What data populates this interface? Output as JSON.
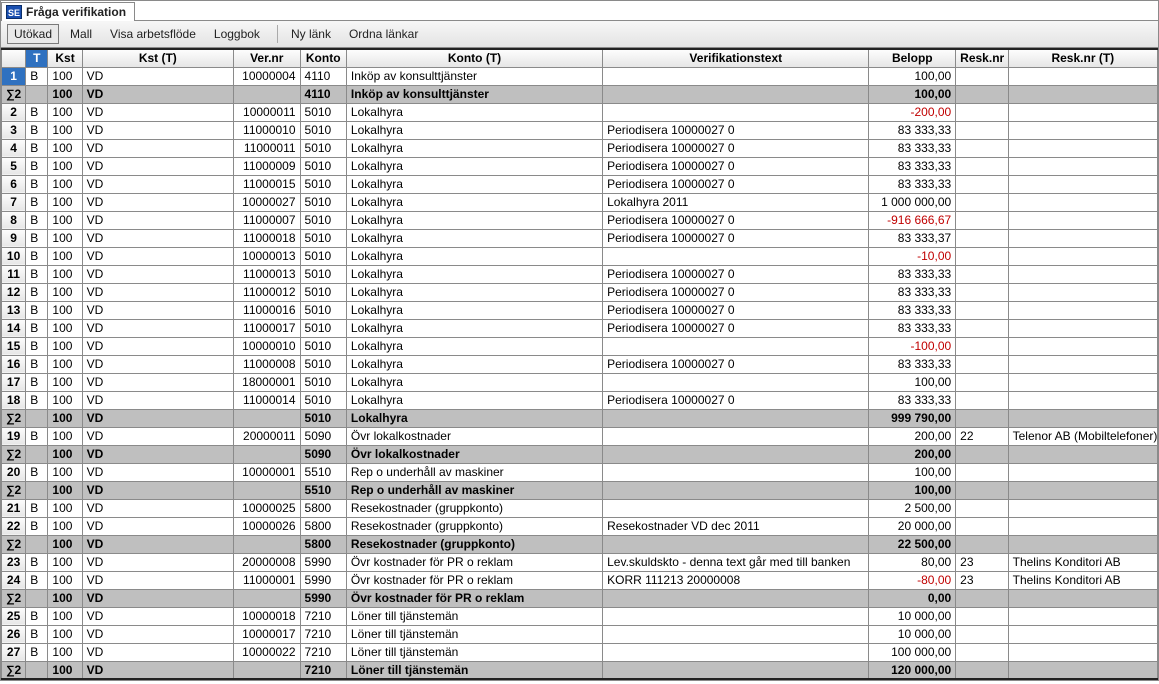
{
  "window": {
    "title": "Fråga verifikation",
    "se_badge": "SE"
  },
  "toolbar": {
    "utokad": "Utökad",
    "mall": "Mall",
    "visa_arbetsflode": "Visa arbetsflöde",
    "loggbok": "Loggbok",
    "ny_lank": "Ny länk",
    "ordna_lankar": "Ordna länkar"
  },
  "columns": {
    "t": "T",
    "kst": "Kst",
    "kstt": "Kst (T)",
    "ver": "Ver.nr",
    "konto": "Konto",
    "kontot": "Konto (T)",
    "vtext": "Verifikationstext",
    "belopp": "Belopp",
    "resk": "Resk.nr",
    "reskt": "Resk.nr (T)"
  },
  "sigma": "∑2",
  "rows": [
    {
      "type": "data",
      "idx": "1",
      "sel": true,
      "t": "B",
      "kst": "100",
      "kstt": "VD",
      "ver": "10000004",
      "konto": "4110",
      "kontot": "Inköp av konsulttjänster",
      "vtext": "",
      "belopp": "100,00",
      "resk": "",
      "reskt": ""
    },
    {
      "type": "sum",
      "kst": "100",
      "kstt": "VD",
      "konto": "4110",
      "kontot": "Inköp av konsulttjänster",
      "belopp": "100,00"
    },
    {
      "type": "data",
      "idx": "2",
      "t": "B",
      "kst": "100",
      "kstt": "VD",
      "ver": "10000011",
      "konto": "5010",
      "kontot": "Lokalhyra",
      "vtext": "",
      "belopp": "-200,00",
      "neg": true,
      "resk": "",
      "reskt": ""
    },
    {
      "type": "data",
      "idx": "3",
      "t": "B",
      "kst": "100",
      "kstt": "VD",
      "ver": "11000010",
      "konto": "5010",
      "kontot": "Lokalhyra",
      "vtext": "Periodisera 10000027 0",
      "belopp": "83 333,33",
      "resk": "",
      "reskt": ""
    },
    {
      "type": "data",
      "idx": "4",
      "t": "B",
      "kst": "100",
      "kstt": "VD",
      "ver": "11000011",
      "konto": "5010",
      "kontot": "Lokalhyra",
      "vtext": "Periodisera 10000027 0",
      "belopp": "83 333,33",
      "resk": "",
      "reskt": ""
    },
    {
      "type": "data",
      "idx": "5",
      "t": "B",
      "kst": "100",
      "kstt": "VD",
      "ver": "11000009",
      "konto": "5010",
      "kontot": "Lokalhyra",
      "vtext": "Periodisera 10000027 0",
      "belopp": "83 333,33",
      "resk": "",
      "reskt": ""
    },
    {
      "type": "data",
      "idx": "6",
      "t": "B",
      "kst": "100",
      "kstt": "VD",
      "ver": "11000015",
      "konto": "5010",
      "kontot": "Lokalhyra",
      "vtext": "Periodisera 10000027 0",
      "belopp": "83 333,33",
      "resk": "",
      "reskt": ""
    },
    {
      "type": "data",
      "idx": "7",
      "t": "B",
      "kst": "100",
      "kstt": "VD",
      "ver": "10000027",
      "konto": "5010",
      "kontot": "Lokalhyra",
      "vtext": "Lokalhyra 2011",
      "belopp": "1 000 000,00",
      "resk": "",
      "reskt": ""
    },
    {
      "type": "data",
      "idx": "8",
      "t": "B",
      "kst": "100",
      "kstt": "VD",
      "ver": "11000007",
      "konto": "5010",
      "kontot": "Lokalhyra",
      "vtext": "Periodisera 10000027 0",
      "belopp": "-916 666,67",
      "neg": true,
      "resk": "",
      "reskt": ""
    },
    {
      "type": "data",
      "idx": "9",
      "t": "B",
      "kst": "100",
      "kstt": "VD",
      "ver": "11000018",
      "konto": "5010",
      "kontot": "Lokalhyra",
      "vtext": "Periodisera 10000027 0",
      "belopp": "83 333,37",
      "resk": "",
      "reskt": ""
    },
    {
      "type": "data",
      "idx": "10",
      "t": "B",
      "kst": "100",
      "kstt": "VD",
      "ver": "10000013",
      "konto": "5010",
      "kontot": "Lokalhyra",
      "vtext": "",
      "belopp": "-10,00",
      "neg": true,
      "resk": "",
      "reskt": ""
    },
    {
      "type": "data",
      "idx": "11",
      "t": "B",
      "kst": "100",
      "kstt": "VD",
      "ver": "11000013",
      "konto": "5010",
      "kontot": "Lokalhyra",
      "vtext": "Periodisera 10000027 0",
      "belopp": "83 333,33",
      "resk": "",
      "reskt": ""
    },
    {
      "type": "data",
      "idx": "12",
      "t": "B",
      "kst": "100",
      "kstt": "VD",
      "ver": "11000012",
      "konto": "5010",
      "kontot": "Lokalhyra",
      "vtext": "Periodisera 10000027 0",
      "belopp": "83 333,33",
      "resk": "",
      "reskt": ""
    },
    {
      "type": "data",
      "idx": "13",
      "t": "B",
      "kst": "100",
      "kstt": "VD",
      "ver": "11000016",
      "konto": "5010",
      "kontot": "Lokalhyra",
      "vtext": "Periodisera 10000027 0",
      "belopp": "83 333,33",
      "resk": "",
      "reskt": ""
    },
    {
      "type": "data",
      "idx": "14",
      "t": "B",
      "kst": "100",
      "kstt": "VD",
      "ver": "11000017",
      "konto": "5010",
      "kontot": "Lokalhyra",
      "vtext": "Periodisera 10000027 0",
      "belopp": "83 333,33",
      "resk": "",
      "reskt": ""
    },
    {
      "type": "data",
      "idx": "15",
      "t": "B",
      "kst": "100",
      "kstt": "VD",
      "ver": "10000010",
      "konto": "5010",
      "kontot": "Lokalhyra",
      "vtext": "",
      "belopp": "-100,00",
      "neg": true,
      "resk": "",
      "reskt": ""
    },
    {
      "type": "data",
      "idx": "16",
      "t": "B",
      "kst": "100",
      "kstt": "VD",
      "ver": "11000008",
      "konto": "5010",
      "kontot": "Lokalhyra",
      "vtext": "Periodisera 10000027 0",
      "belopp": "83 333,33",
      "resk": "",
      "reskt": ""
    },
    {
      "type": "data",
      "idx": "17",
      "t": "B",
      "kst": "100",
      "kstt": "VD",
      "ver": "18000001",
      "konto": "5010",
      "kontot": "Lokalhyra",
      "vtext": "",
      "belopp": "100,00",
      "resk": "",
      "reskt": ""
    },
    {
      "type": "data",
      "idx": "18",
      "t": "B",
      "kst": "100",
      "kstt": "VD",
      "ver": "11000014",
      "konto": "5010",
      "kontot": "Lokalhyra",
      "vtext": "Periodisera 10000027 0",
      "belopp": "83 333,33",
      "resk": "",
      "reskt": ""
    },
    {
      "type": "sum",
      "kst": "100",
      "kstt": "VD",
      "konto": "5010",
      "kontot": "Lokalhyra",
      "belopp": "999 790,00"
    },
    {
      "type": "data",
      "idx": "19",
      "t": "B",
      "kst": "100",
      "kstt": "VD",
      "ver": "20000011",
      "konto": "5090",
      "kontot": "Övr lokalkostnader",
      "vtext": "",
      "belopp": "200,00",
      "resk": "22",
      "reskt": "Telenor AB (Mobiltelefoner)"
    },
    {
      "type": "sum",
      "kst": "100",
      "kstt": "VD",
      "konto": "5090",
      "kontot": "Övr lokalkostnader",
      "belopp": "200,00"
    },
    {
      "type": "data",
      "idx": "20",
      "t": "B",
      "kst": "100",
      "kstt": "VD",
      "ver": "10000001",
      "konto": "5510",
      "kontot": "Rep o underhåll av maskiner",
      "vtext": "",
      "belopp": "100,00",
      "resk": "",
      "reskt": ""
    },
    {
      "type": "sum",
      "kst": "100",
      "kstt": "VD",
      "konto": "5510",
      "kontot": "Rep o underhåll av maskiner",
      "belopp": "100,00"
    },
    {
      "type": "data",
      "idx": "21",
      "t": "B",
      "kst": "100",
      "kstt": "VD",
      "ver": "10000025",
      "konto": "5800",
      "kontot": "Resekostnader (gruppkonto)",
      "vtext": "",
      "belopp": "2 500,00",
      "resk": "",
      "reskt": ""
    },
    {
      "type": "data",
      "idx": "22",
      "t": "B",
      "kst": "100",
      "kstt": "VD",
      "ver": "10000026",
      "konto": "5800",
      "kontot": "Resekostnader (gruppkonto)",
      "vtext": "Resekostnader VD dec 2011",
      "belopp": "20 000,00",
      "resk": "",
      "reskt": ""
    },
    {
      "type": "sum",
      "kst": "100",
      "kstt": "VD",
      "konto": "5800",
      "kontot": "Resekostnader (gruppkonto)",
      "belopp": "22 500,00"
    },
    {
      "type": "data",
      "idx": "23",
      "t": "B",
      "kst": "100",
      "kstt": "VD",
      "ver": "20000008",
      "konto": "5990",
      "kontot": "Övr kostnader för PR o reklam",
      "vtext": "Lev.skuldskto - denna text går med till banken",
      "belopp": "80,00",
      "resk": "23",
      "reskt": "Thelins Konditori AB"
    },
    {
      "type": "data",
      "idx": "24",
      "t": "B",
      "kst": "100",
      "kstt": "VD",
      "ver": "11000001",
      "konto": "5990",
      "kontot": "Övr kostnader för PR o reklam",
      "vtext": "KORR 111213 20000008",
      "belopp": "-80,00",
      "neg": true,
      "resk": "23",
      "reskt": "Thelins Konditori AB"
    },
    {
      "type": "sum",
      "kst": "100",
      "kstt": "VD",
      "konto": "5990",
      "kontot": "Övr kostnader för PR o reklam",
      "belopp": "0,00"
    },
    {
      "type": "data",
      "idx": "25",
      "t": "B",
      "kst": "100",
      "kstt": "VD",
      "ver": "10000018",
      "konto": "7210",
      "kontot": "Löner till tjänstemän",
      "vtext": "",
      "belopp": "10 000,00",
      "resk": "",
      "reskt": ""
    },
    {
      "type": "data",
      "idx": "26",
      "t": "B",
      "kst": "100",
      "kstt": "VD",
      "ver": "10000017",
      "konto": "7210",
      "kontot": "Löner till tjänstemän",
      "vtext": "",
      "belopp": "10 000,00",
      "resk": "",
      "reskt": ""
    },
    {
      "type": "data",
      "idx": "27",
      "t": "B",
      "kst": "100",
      "kstt": "VD",
      "ver": "10000022",
      "konto": "7210",
      "kontot": "Löner till tjänstemän",
      "vtext": "",
      "belopp": "100 000,00",
      "resk": "",
      "reskt": ""
    },
    {
      "type": "sum",
      "kst": "100",
      "kstt": "VD",
      "konto": "7210",
      "kontot": "Löner till tjänstemän",
      "belopp": "120 000,00",
      "last": true
    }
  ]
}
